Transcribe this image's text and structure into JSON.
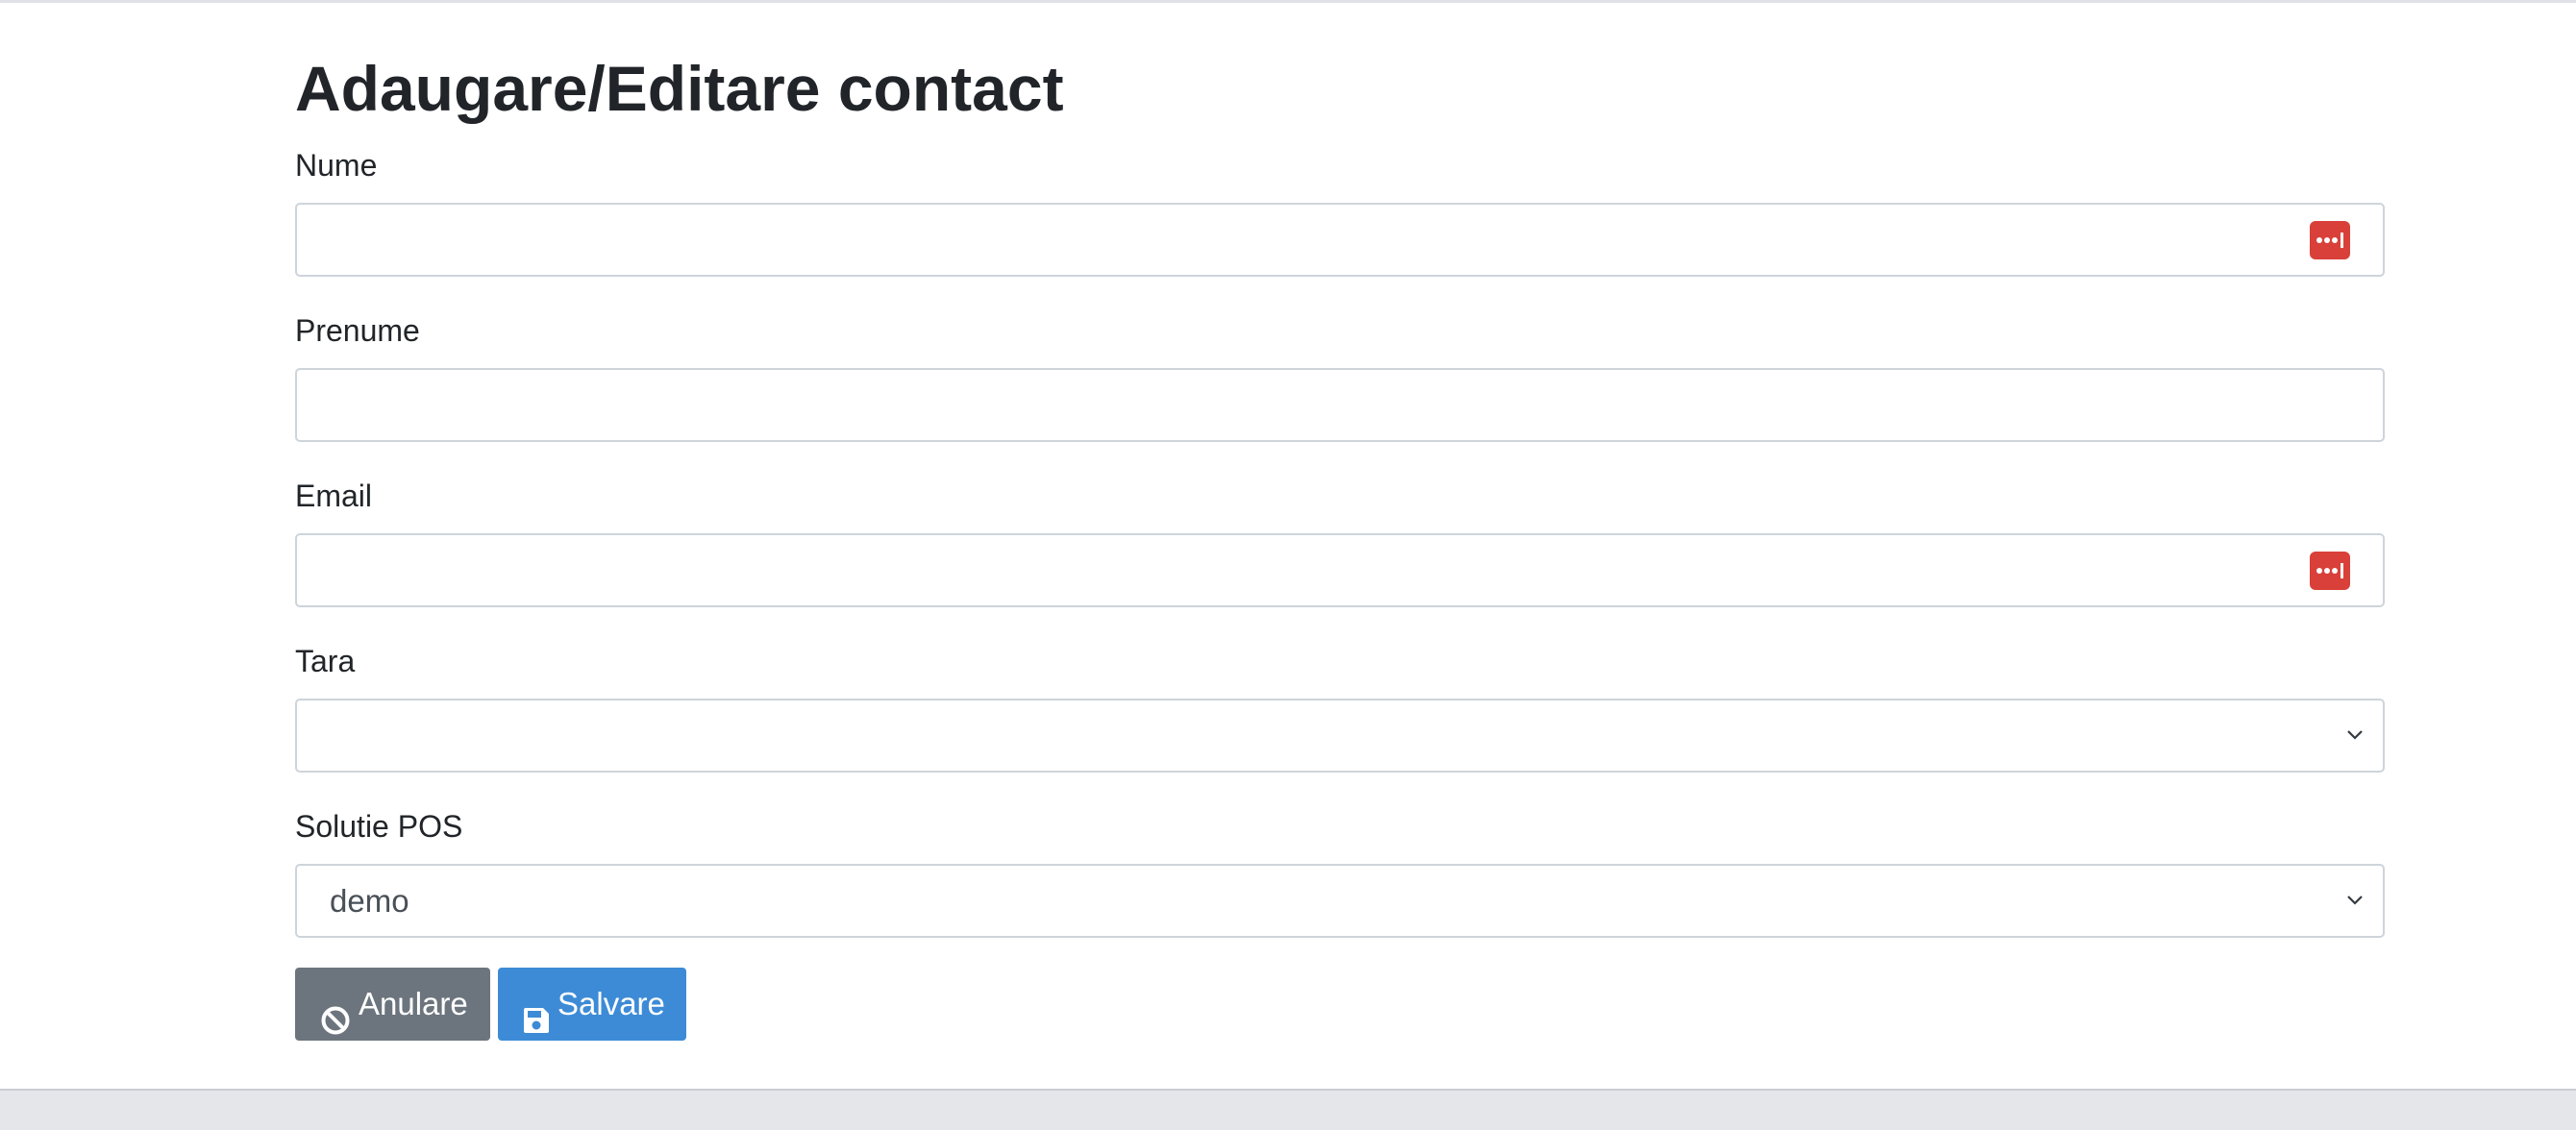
{
  "form": {
    "title": "Adaugare/Editare contact",
    "fields": {
      "nume": {
        "label": "Nume",
        "value": "",
        "icon": "password-manager-icon"
      },
      "prenume": {
        "label": "Prenume",
        "value": ""
      },
      "email": {
        "label": "Email",
        "value": "",
        "icon": "password-manager-icon"
      },
      "tara": {
        "label": "Tara",
        "selected": ""
      },
      "solutie_pos": {
        "label": "Solutie POS",
        "selected": "demo"
      }
    },
    "buttons": {
      "cancel": {
        "label": "Anulare",
        "icon": "ban-icon"
      },
      "save": {
        "label": "Salvare",
        "icon": "floppy-disk-icon"
      }
    }
  },
  "colors": {
    "cancel_button": "#6c757d",
    "save_button": "#3d8bd6",
    "password_manager_icon": "#d9403a",
    "footer_band": "#e4e6e9"
  }
}
